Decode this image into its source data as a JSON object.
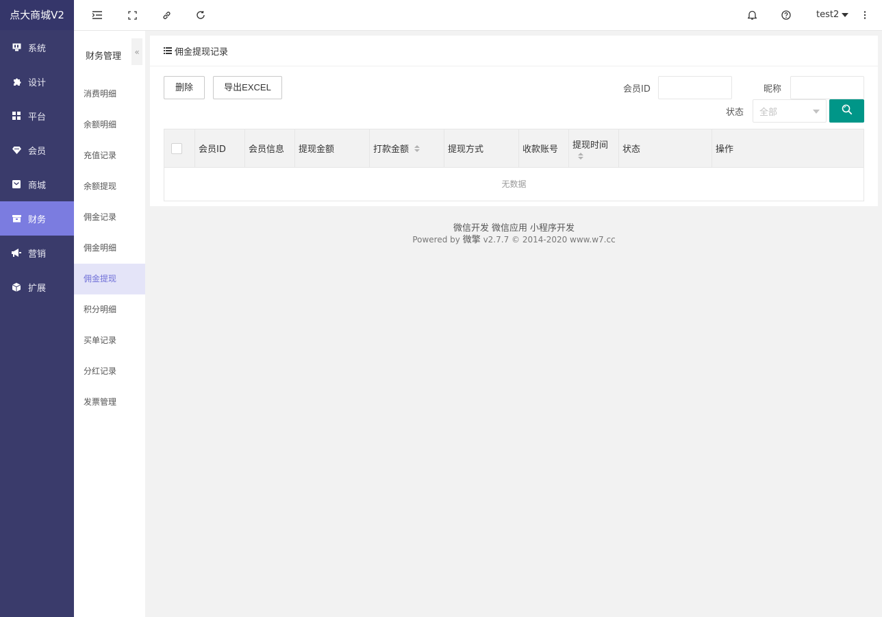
{
  "brand": "点大商城V2",
  "nav": [
    {
      "label": "系统",
      "icon": "monitor-icon"
    },
    {
      "label": "设计",
      "icon": "puzzle-icon"
    },
    {
      "label": "平台",
      "icon": "grid-icon"
    },
    {
      "label": "会员",
      "icon": "diamond-icon"
    },
    {
      "label": "商城",
      "icon": "mail-icon"
    },
    {
      "label": "财务",
      "icon": "wallet-icon",
      "active": true
    },
    {
      "label": "营销",
      "icon": "megaphone-icon"
    },
    {
      "label": "扩展",
      "icon": "cube-icon"
    }
  ],
  "topbar": {
    "icons": [
      "menu-fold-icon",
      "fullscreen-icon",
      "link-icon",
      "refresh-icon"
    ],
    "right_icons": [
      "bell-icon",
      "help-icon",
      "more-icon"
    ],
    "username": "test2"
  },
  "subnav": {
    "title": "财务管理",
    "collapse_glyph": "«",
    "items": [
      "消费明细",
      "余额明细",
      "充值记录",
      "余额提现",
      "佣金记录",
      "佣金明细",
      "佣金提现",
      "积分明细",
      "买单记录",
      "分红记录",
      "发票管理"
    ],
    "active_index": 6
  },
  "panel": {
    "title": "佣金提现记录",
    "delete_label": "删除",
    "export_label": "导出EXCEL",
    "member_id_label": "会员ID",
    "member_id_value": "",
    "nickname_label": "昵称",
    "nickname_value": "",
    "status_label": "状态",
    "status_selected": "全部"
  },
  "table": {
    "columns": [
      "会员ID",
      "会员信息",
      "提现金额",
      "打款金额",
      "提现方式",
      "收款账号",
      "提现时间",
      "状态",
      "操作"
    ],
    "empty_text": "无数据"
  },
  "footer": {
    "links": [
      "微信开发",
      "微信应用",
      "小程序开发"
    ],
    "powered_prefix": "Powered by",
    "powered_brand": "微擎",
    "powered_suffix": "v2.7.7 © 2014-2020 www.w7.cc"
  },
  "colors": {
    "sidebar": "#3a3b6b",
    "active_nav": "#7b7ce0",
    "search_button": "#009688"
  }
}
